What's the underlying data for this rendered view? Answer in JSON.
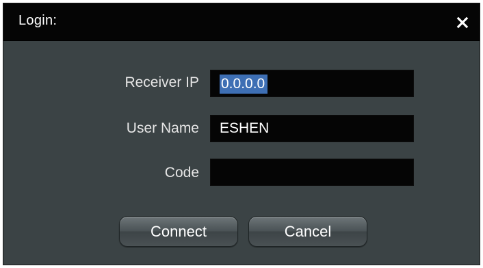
{
  "dialog": {
    "title": "Login:",
    "close_icon": "close-icon"
  },
  "form": {
    "receiver_ip_label": "Receiver IP",
    "receiver_ip_value": "0.0.0.0",
    "user_name_label": "User Name",
    "user_name_value": "ESHEN",
    "code_label": "Code",
    "code_value": ""
  },
  "buttons": {
    "connect_label": "Connect",
    "cancel_label": "Cancel"
  },
  "colors": {
    "dialog_bg": "#3b4345",
    "titlebar_bg": "#050505",
    "field_bg": "#050505",
    "selection": "#3e6fb4"
  }
}
